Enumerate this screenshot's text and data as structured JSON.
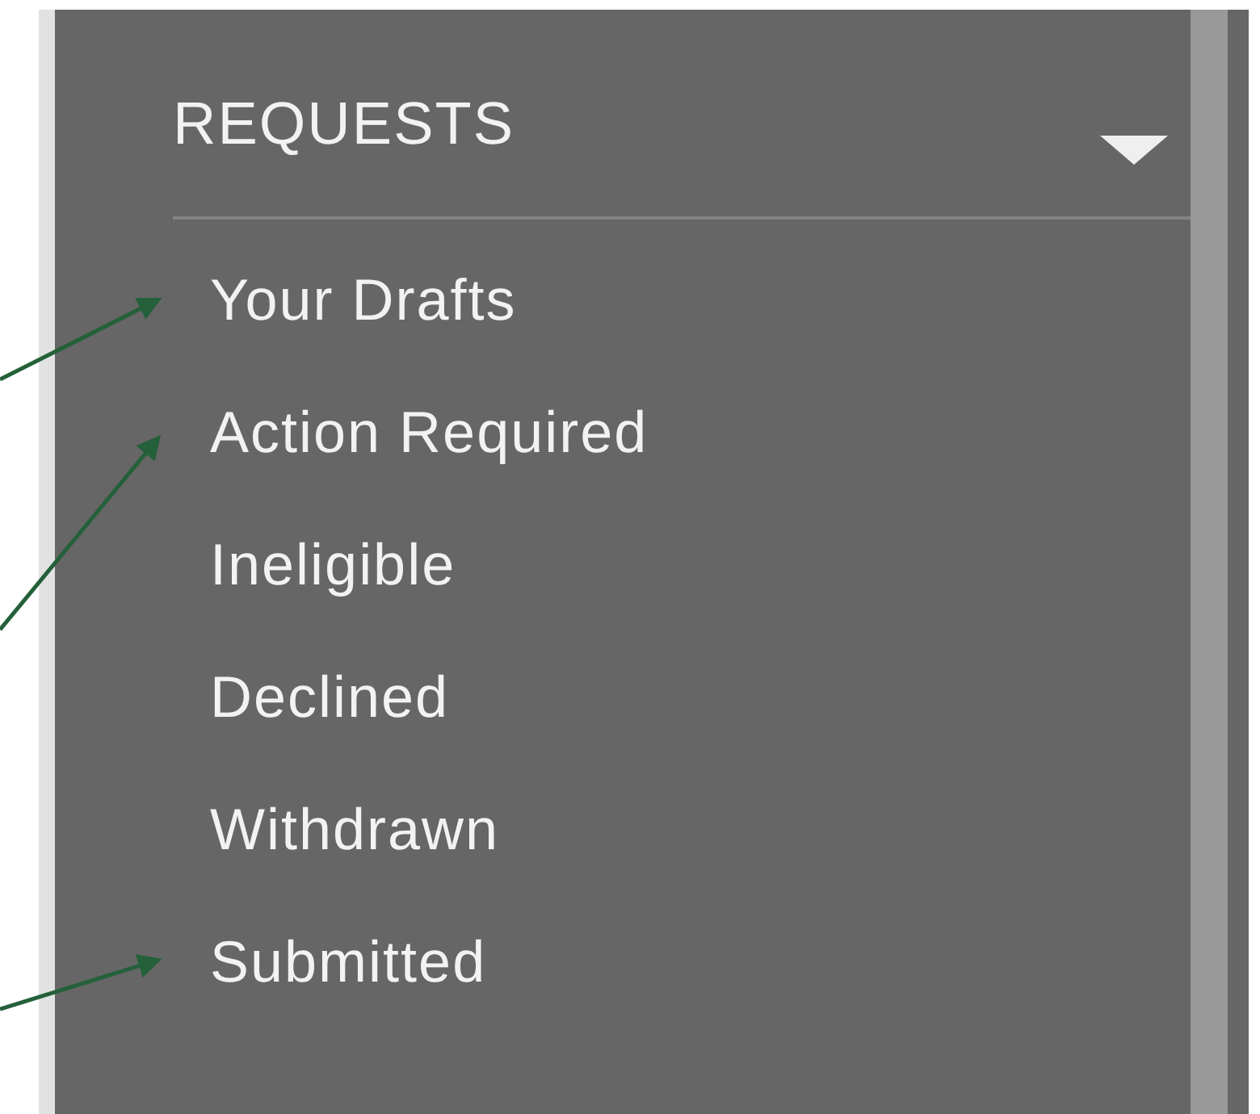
{
  "menu": {
    "title": "REQUESTS",
    "expanded": true,
    "items": [
      {
        "label": "Your Drafts",
        "highlighted": true
      },
      {
        "label": "Action Required",
        "highlighted": true
      },
      {
        "label": "Ineligible",
        "highlighted": false
      },
      {
        "label": "Declined",
        "highlighted": false
      },
      {
        "label": "Withdrawn",
        "highlighted": false
      },
      {
        "label": "Submitted",
        "highlighted": true
      }
    ]
  }
}
